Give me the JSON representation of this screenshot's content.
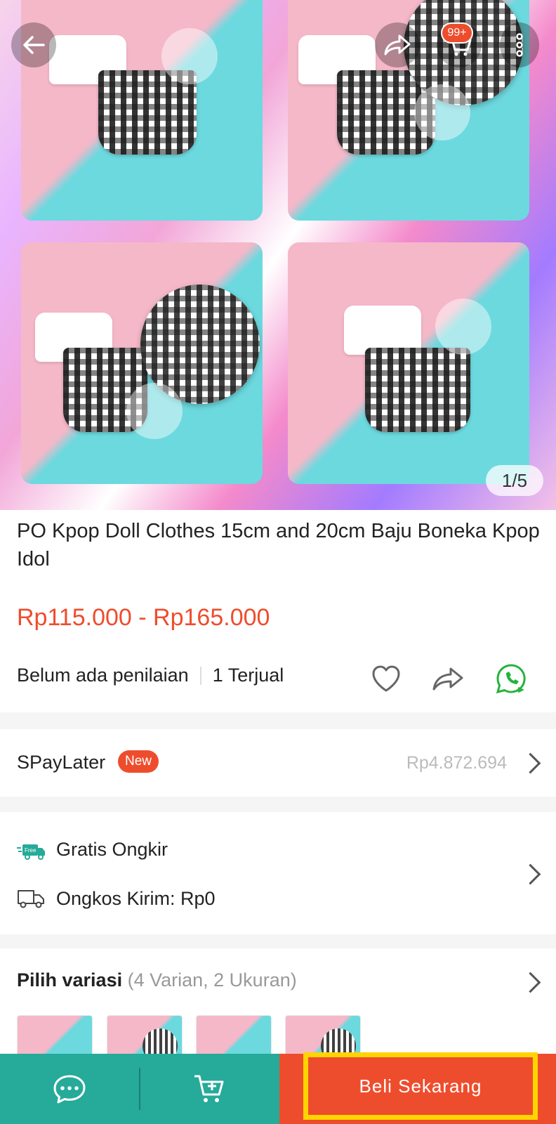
{
  "hero": {
    "image_counter": "1/5",
    "cart_badge": "99+",
    "icons": [
      "back-arrow-icon",
      "share-icon",
      "cart-icon",
      "more-vertical-icon"
    ]
  },
  "product": {
    "title": "PO Kpop Doll Clothes 15cm and 20cm Baju Boneka Kpop Idol",
    "price": "Rp115.000 - Rp165.000",
    "rating_text": "Belum ada penilaian",
    "sold_text": "1 Terjual"
  },
  "paylater": {
    "label": "SPayLater",
    "tag": "New",
    "value": "Rp4.872.694"
  },
  "shipping": {
    "free_badge": "Free",
    "free_label": "Gratis Ongkir",
    "cost_label": "Ongkos Kirim: Rp0"
  },
  "variation": {
    "label": "Pilih variasi",
    "detail": "(4 Varian, 2 Ukuran)"
  },
  "bottom_bar": {
    "buy_now": "Beli Sekarang"
  },
  "colors": {
    "accent": "#ee4d2d",
    "green": "#26aa99",
    "highlight": "#ffd400"
  }
}
